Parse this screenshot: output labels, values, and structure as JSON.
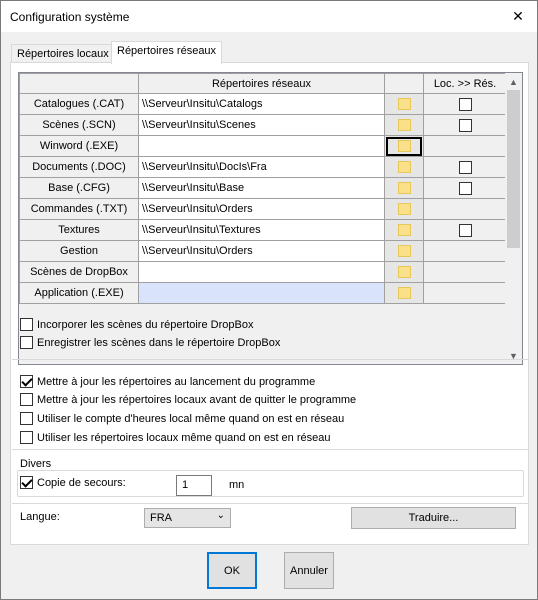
{
  "window": {
    "title": "Configuration système",
    "close_glyph": "✕"
  },
  "tabs": [
    {
      "label": "Répertoires locaux",
      "active": false
    },
    {
      "label": "Répertoires réseaux",
      "active": true
    }
  ],
  "grid": {
    "columns": {
      "paths": "Répertoires réseaux",
      "loc_res": "Loc. >> Rés."
    },
    "rows": [
      {
        "label": "Catalogues (.CAT)",
        "path": "\\\\Serveur\\Insitu\\Catalogs",
        "has_checkbox": true,
        "checked": false
      },
      {
        "label": "Scènes (.SCN)",
        "path": "\\\\Serveur\\Insitu\\Scenes",
        "has_checkbox": true,
        "checked": false
      },
      {
        "label": "Winword (.EXE)",
        "path": "",
        "has_checkbox": false,
        "checked": false,
        "focused_button": true
      },
      {
        "label": "Documents (.DOC)",
        "path": "\\\\Serveur\\Insitu\\DocIs\\Fra",
        "has_checkbox": true,
        "checked": false
      },
      {
        "label": "Base (.CFG)",
        "path": "\\\\Serveur\\Insitu\\Base",
        "has_checkbox": true,
        "checked": false
      },
      {
        "label": "Commandes (.TXT)",
        "path": "\\\\Serveur\\Insitu\\Orders",
        "has_checkbox": false,
        "checked": false
      },
      {
        "label": "Textures",
        "path": "\\\\Serveur\\Insitu\\Textures",
        "has_checkbox": true,
        "checked": false
      },
      {
        "label": "Gestion",
        "path": "\\\\Serveur\\Insitu\\Orders",
        "has_checkbox": false,
        "checked": false
      },
      {
        "label": "Scènes de DropBox",
        "path": "",
        "has_checkbox": false,
        "checked": false
      },
      {
        "label": "Application (.EXE)",
        "path": "",
        "has_checkbox": false,
        "checked": false,
        "selected": true
      }
    ]
  },
  "dropbox_options": [
    {
      "label": "Incorporer les scènes du répertoire DropBox",
      "checked": false
    },
    {
      "label": "Enregistrer les scènes dans le répertoire DropBox",
      "checked": false
    }
  ],
  "general_options": [
    {
      "label": "Mettre à jour les répertoires au lancement du programme",
      "checked": true
    },
    {
      "label": "Mettre à jour les répertoires locaux avant de quitter le programme",
      "checked": false
    },
    {
      "label": "Utiliser le compte d'heures local même quand on est en réseau",
      "checked": false
    },
    {
      "label": "Utiliser les répertoires locaux même quand on est en réseau",
      "checked": false
    }
  ],
  "divers": {
    "group_label": "Divers",
    "backup_label": "Copie de secours:",
    "backup_checked": true,
    "backup_value": "1",
    "backup_unit": "mn"
  },
  "language": {
    "label": "Langue:",
    "value": "FRA",
    "translate_button": "Traduire..."
  },
  "footer": {
    "ok": "OK",
    "cancel": "Annuler"
  }
}
